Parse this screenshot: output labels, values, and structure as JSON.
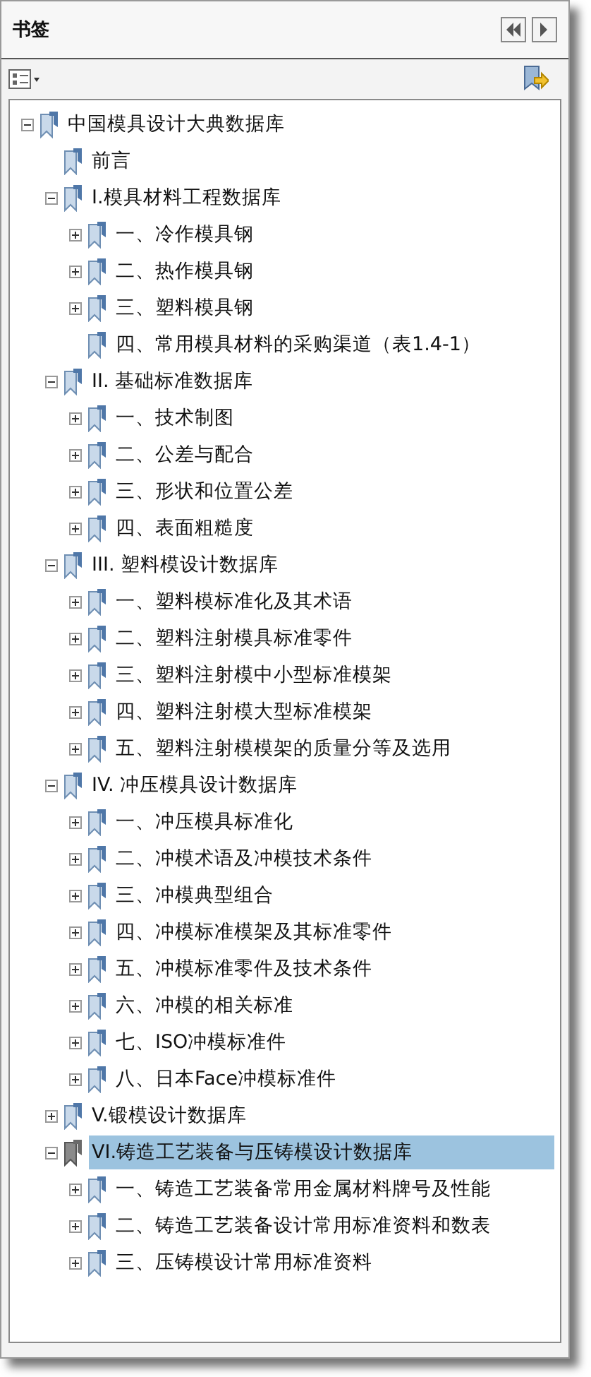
{
  "panel": {
    "title": "书签"
  },
  "bookmarks": [
    {
      "label": "中国模具设计大典数据库",
      "expanded": true,
      "selected": false,
      "children": [
        {
          "label": "前言",
          "selected": false
        },
        {
          "label": "I.模具材料工程数据库",
          "expanded": true,
          "selected": false,
          "children": [
            {
              "label": "一、冷作模具钢",
              "expanded": false,
              "selected": false
            },
            {
              "label": "二、热作模具钢",
              "expanded": false,
              "selected": false
            },
            {
              "label": "三、塑料模具钢",
              "expanded": false,
              "selected": false
            },
            {
              "label": "四、常用模具材料的采购渠道（表1.4-1）",
              "selected": false
            }
          ]
        },
        {
          "label": "II. 基础标准数据库",
          "expanded": true,
          "selected": false,
          "children": [
            {
              "label": "一、技术制图",
              "expanded": false,
              "selected": false
            },
            {
              "label": "二、公差与配合",
              "expanded": false,
              "selected": false
            },
            {
              "label": "三、形状和位置公差",
              "expanded": false,
              "selected": false
            },
            {
              "label": "四、表面粗糙度",
              "expanded": false,
              "selected": false
            }
          ]
        },
        {
          "label": "III. 塑料模设计数据库",
          "expanded": true,
          "selected": false,
          "children": [
            {
              "label": "一、塑料模标准化及其术语",
              "expanded": false,
              "selected": false
            },
            {
              "label": "二、塑料注射模具标准零件",
              "expanded": false,
              "selected": false
            },
            {
              "label": "三、塑料注射模中小型标准模架",
              "expanded": false,
              "selected": false
            },
            {
              "label": "四、塑料注射模大型标准模架",
              "expanded": false,
              "selected": false
            },
            {
              "label": "五、塑料注射模模架的质量分等及选用",
              "expanded": false,
              "selected": false
            }
          ]
        },
        {
          "label": "IV. 冲压模具设计数据库",
          "expanded": true,
          "selected": false,
          "children": [
            {
              "label": "一、冲压模具标准化",
              "expanded": false,
              "selected": false
            },
            {
              "label": "二、冲模术语及冲模技术条件",
              "expanded": false,
              "selected": false
            },
            {
              "label": "三、冲模典型组合",
              "expanded": false,
              "selected": false
            },
            {
              "label": "四、冲模标准模架及其标准零件",
              "expanded": false,
              "selected": false
            },
            {
              "label": "五、冲模标准零件及技术条件",
              "expanded": false,
              "selected": false
            },
            {
              "label": "六、冲模的相关标准",
              "expanded": false,
              "selected": false
            },
            {
              "label": "七、ISO冲模标准件",
              "expanded": false,
              "selected": false
            },
            {
              "label": "八、日本Face冲模标准件",
              "expanded": false,
              "selected": false
            }
          ]
        },
        {
          "label": "V.锻模设计数据库",
          "expanded": false,
          "selected": false
        },
        {
          "label": "VI.铸造工艺装备与压铸模设计数据库",
          "expanded": true,
          "selected": true,
          "children": [
            {
              "label": "一、铸造工艺装备常用金属材料牌号及性能",
              "expanded": false,
              "selected": false
            },
            {
              "label": "二、铸造工艺装备设计常用标准资料和数表",
              "expanded": false,
              "selected": false
            },
            {
              "label": "三、压铸模设计常用标准资料",
              "expanded": false,
              "selected": false
            }
          ]
        }
      ]
    }
  ]
}
